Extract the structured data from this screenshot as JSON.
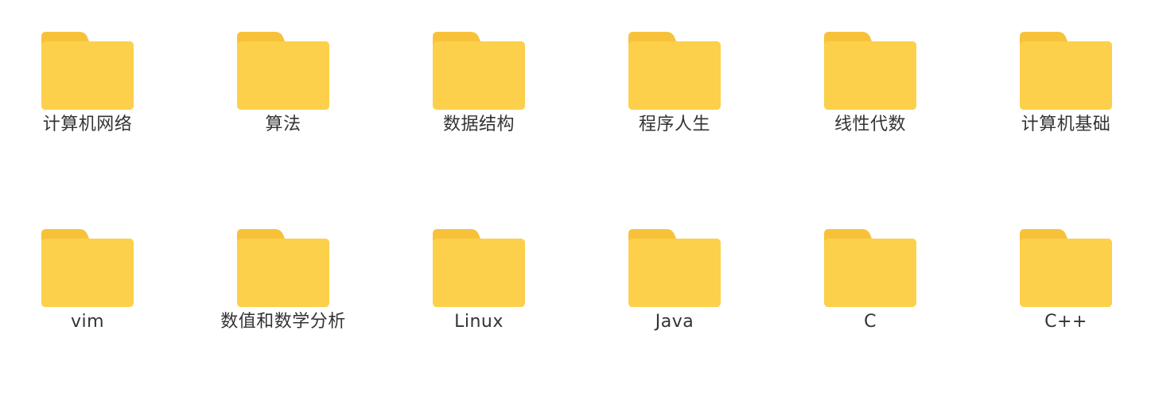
{
  "folders": [
    {
      "label": "计算机网络",
      "icon": "folder-icon"
    },
    {
      "label": "算法",
      "icon": "folder-icon"
    },
    {
      "label": "数据结构",
      "icon": "folder-icon"
    },
    {
      "label": "程序人生",
      "icon": "folder-icon"
    },
    {
      "label": "线性代数",
      "icon": "folder-icon"
    },
    {
      "label": "计算机基础",
      "icon": "folder-icon"
    },
    {
      "label": "vim",
      "icon": "folder-icon"
    },
    {
      "label": "数值和数学分析",
      "icon": "folder-icon"
    },
    {
      "label": "Linux",
      "icon": "folder-icon"
    },
    {
      "label": "Java",
      "icon": "folder-icon"
    },
    {
      "label": "C",
      "icon": "folder-icon"
    },
    {
      "label": "C++",
      "icon": "folder-icon"
    }
  ],
  "colors": {
    "folder_body": "#FDD04B",
    "folder_tab": "#F7C23A",
    "label_text": "#333333",
    "background": "#FFFFFF"
  }
}
